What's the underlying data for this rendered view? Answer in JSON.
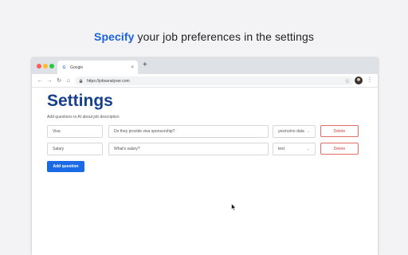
{
  "headline": {
    "accent": "Specify",
    "rest": " your job preferences in the settings"
  },
  "browser": {
    "tab_title": "Google",
    "tab_close": "×",
    "new_tab": "+",
    "url": "https://jobsanalyser.com",
    "nav": {
      "back": "←",
      "forward": "→",
      "reload": "↻",
      "home": "⌂"
    },
    "star": "☆",
    "menu": "⋮",
    "favicon_letter": "G"
  },
  "page": {
    "title": "Settings",
    "subtitle": "Add questions to AI about job description",
    "rows": [
      {
        "name": "Visa",
        "question": "Do they provide visa sponsorship?",
        "type": "yes/no/no data",
        "delete_label": "Delete"
      },
      {
        "name": "Salary",
        "question": "What's salary?",
        "type": "text",
        "delete_label": "Delete"
      }
    ],
    "add_button": "Add question"
  },
  "colors": {
    "accent": "#1a63e0",
    "title": "#17408d",
    "button": "#1a6ae8",
    "delete": "#d83d3d"
  },
  "icons": [
    "chevron-down-icon",
    "lock-icon",
    "star-icon",
    "back-icon",
    "forward-icon",
    "reload-icon",
    "home-icon",
    "kebab-menu-icon",
    "mouse-cursor-icon"
  ]
}
